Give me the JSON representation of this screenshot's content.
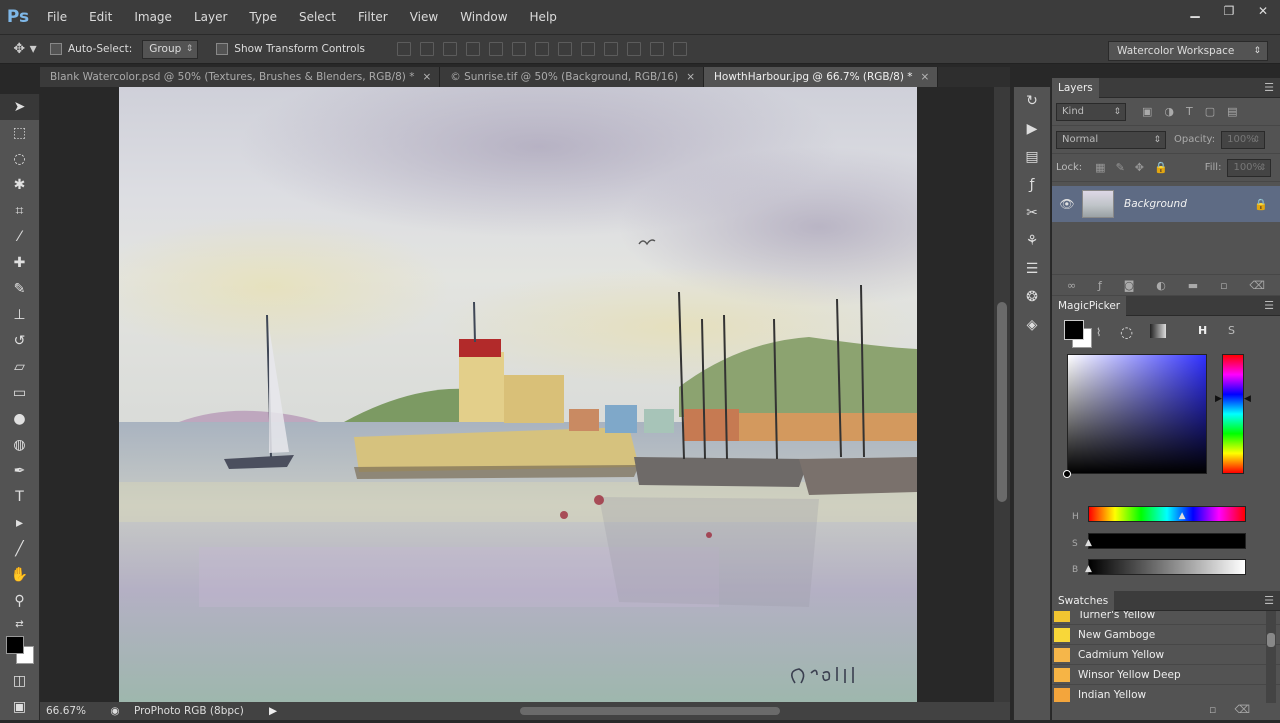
{
  "app": {
    "logo": "Ps"
  },
  "menu": [
    "File",
    "Edit",
    "Image",
    "Layer",
    "Type",
    "Select",
    "Filter",
    "View",
    "Window",
    "Help"
  ],
  "window_controls": {
    "minimize": "▁",
    "restore": "❐",
    "close": "✕"
  },
  "options": {
    "auto_select_label": "Auto-Select:",
    "auto_select_value": "Group",
    "transform_label": "Show Transform Controls",
    "workspace": "Watercolor Workspace"
  },
  "tabs": [
    {
      "label": "Blank Watercolor.psd @ 50% (Textures, Brushes & Blenders, RGB/8) *",
      "close": "×"
    },
    {
      "label": "© Sunrise.tif @ 50% (Background, RGB/16)",
      "close": "×"
    },
    {
      "label": "HowthHarbour.jpg @ 66.7% (RGB/8) *",
      "close": "×"
    }
  ],
  "status": {
    "zoom": "66.67%",
    "profile": "ProPhoto RGB (8bpc)"
  },
  "layers_panel": {
    "title": "Layers",
    "filter": "Kind",
    "blend_mode": "Normal",
    "opacity_label": "Opacity:",
    "opacity_value": "100%",
    "lock_label": "Lock:",
    "fill_label": "Fill:",
    "fill_value": "100%",
    "layer_name": "Background"
  },
  "magicpicker": {
    "title": "MagicPicker",
    "h_button": "H",
    "s_button": "S",
    "h_label": "H",
    "s_label": "S",
    "b_label": "B",
    "hue_level": 0.6,
    "saturation_level": 0,
    "brightness_level": 0
  },
  "swatches": {
    "title": "Swatches",
    "items": [
      {
        "name": "Turner's Yellow",
        "color": "#f2c531"
      },
      {
        "name": "New Gamboge",
        "color": "#f8d739"
      },
      {
        "name": "Cadmium Yellow",
        "color": "#f5b64a"
      },
      {
        "name": "Winsor Yellow Deep",
        "color": "#f6b445"
      },
      {
        "name": "Indian Yellow",
        "color": "#f3a53c"
      }
    ]
  },
  "signature": "G.Odill"
}
